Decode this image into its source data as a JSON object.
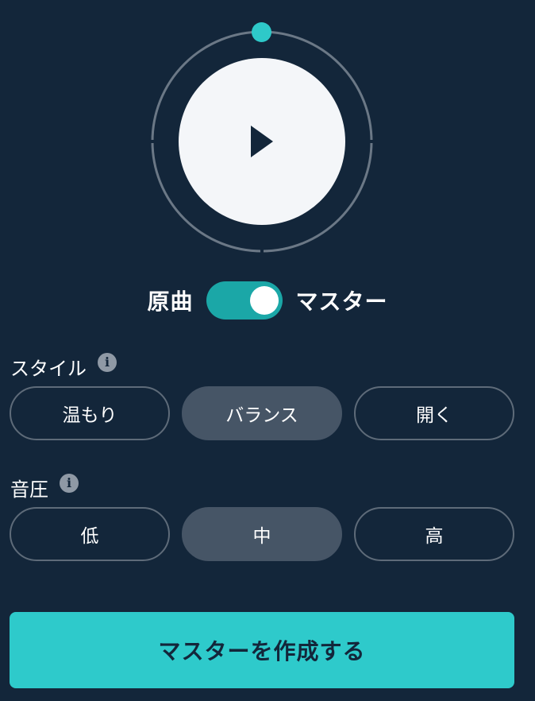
{
  "player": {
    "play_icon": "play-icon",
    "progress": 0
  },
  "toggle": {
    "left_label": "原曲",
    "right_label": "マスター",
    "state": "on",
    "color": "#1ba7a7"
  },
  "style_section": {
    "title": "スタイル",
    "info_icon": "info-icon",
    "options": [
      "温もり",
      "バランス",
      "開く"
    ],
    "selected": "バランス"
  },
  "loudness_section": {
    "title": "音圧",
    "info_icon": "info-icon",
    "options": [
      "低",
      "中",
      "高"
    ],
    "selected": "中"
  },
  "create_button": {
    "label": "マスターを作成する",
    "color": "#2ecacb"
  },
  "colors": {
    "background": "#13263a",
    "accent": "#2ecacb",
    "selected_option": "#465566"
  }
}
